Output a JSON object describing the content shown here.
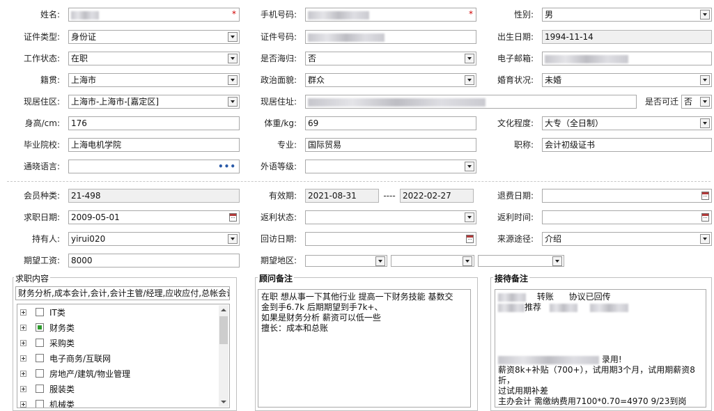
{
  "row1": {
    "name_label": "姓名:",
    "phone_label": "手机号码:",
    "gender_label": "性别:",
    "gender_value": "男",
    "required_mark": "*"
  },
  "row2": {
    "idtype_label": "证件类型:",
    "idtype_value": "身份证",
    "idno_label": "证件号码:",
    "birth_label": "出生日期:",
    "birth_value": "1994-11-14"
  },
  "row3": {
    "work_label": "工作状态:",
    "work_value": "在职",
    "overseas_label": "是否海归:",
    "overseas_value": "否",
    "email_label": "电子邮箱:"
  },
  "row4": {
    "native_label": "籍贯:",
    "native_value": "上海市",
    "political_label": "政治面貌:",
    "political_value": "群众",
    "marital_label": "婚育状况:",
    "marital_value": "未婚"
  },
  "row5": {
    "area_label": "现居住区:",
    "area_value": "上海市-上海市-[嘉定区]",
    "addr_label": "现居住址:",
    "relocate_label": "是否可迁",
    "relocate_value": "否"
  },
  "row6": {
    "height_label": "身高/cm:",
    "height_value": "176",
    "weight_label": "体重/kg:",
    "weight_value": "69",
    "edu_label": "文化程度:",
    "edu_value": "大专（全日制）"
  },
  "row7": {
    "school_label": "毕业院校:",
    "school_value": "上海电机学院",
    "major_label": "专业:",
    "major_value": "国际贸易",
    "title_label": "职称:",
    "title_value": "会计初级证书"
  },
  "row8": {
    "lang_label": "通晓语言:",
    "lang_value": "",
    "foreign_label": "外语等级:",
    "foreign_value": ""
  },
  "member": {
    "type_label": "会员种类:",
    "type_value": "21-498",
    "valid_label": "有效期:",
    "valid_from": "2021-08-31",
    "valid_sep": "----",
    "valid_to": "2022-02-27",
    "refund_label": "退费日期:",
    "refund_value": "",
    "jobdate_label": "求职日期:",
    "jobdate_value": "2009-05-01",
    "rebate_status_label": "返利状态:",
    "rebate_status_value": "",
    "rebate_time_label": "返利时间:",
    "rebate_time_value": "",
    "holder_label": "持有人:",
    "holder_value": "yirui020",
    "visit_label": "回访日期:",
    "visit_value": "",
    "source_label": "来源途径:",
    "source_value": "介绍",
    "salary_label": "期望工资:",
    "salary_value": "8000",
    "region_label": "期望地区:"
  },
  "job_content": {
    "title": "求职内容",
    "summary": "财务分析,成本会计,会计,会计主管/经理,应收应付,总帐会计",
    "tree": [
      {
        "label": "IT类",
        "checked": false
      },
      {
        "label": "财务类",
        "checked": true
      },
      {
        "label": "采购类",
        "checked": false
      },
      {
        "label": "电子商务/互联网",
        "checked": false
      },
      {
        "label": "房地产/建筑/物业管理",
        "checked": false
      },
      {
        "label": "服装类",
        "checked": false
      },
      {
        "label": "机械类",
        "checked": false
      }
    ]
  },
  "advisor_note": {
    "title": "顾问备注",
    "line1": "在职  想从事一下其他行业 提高一下财务技能  基数交",
    "line2": "金到手6.7k   后期期望到手7k+、",
    "line3": "如果是财务分析 薪资可以低一些",
    "line4": "擅长：成本和总账"
  },
  "reception_note": {
    "title": "接待备注",
    "line1a": "转账",
    "line1b": "协议已回传",
    "line2": "推荐",
    "line3": "录用!",
    "line4": "薪资8k+补贴（700+），试用期3个月，试用期薪资8折，",
    "line5": "过试用期补差",
    "line6": "主办会计 需缴纳费用7100*0.70=4970 9/23到岗"
  },
  "colors": {
    "required": "#d10000",
    "checked": "#2e9b2e",
    "readonly_bg": "#f0f0f0"
  }
}
